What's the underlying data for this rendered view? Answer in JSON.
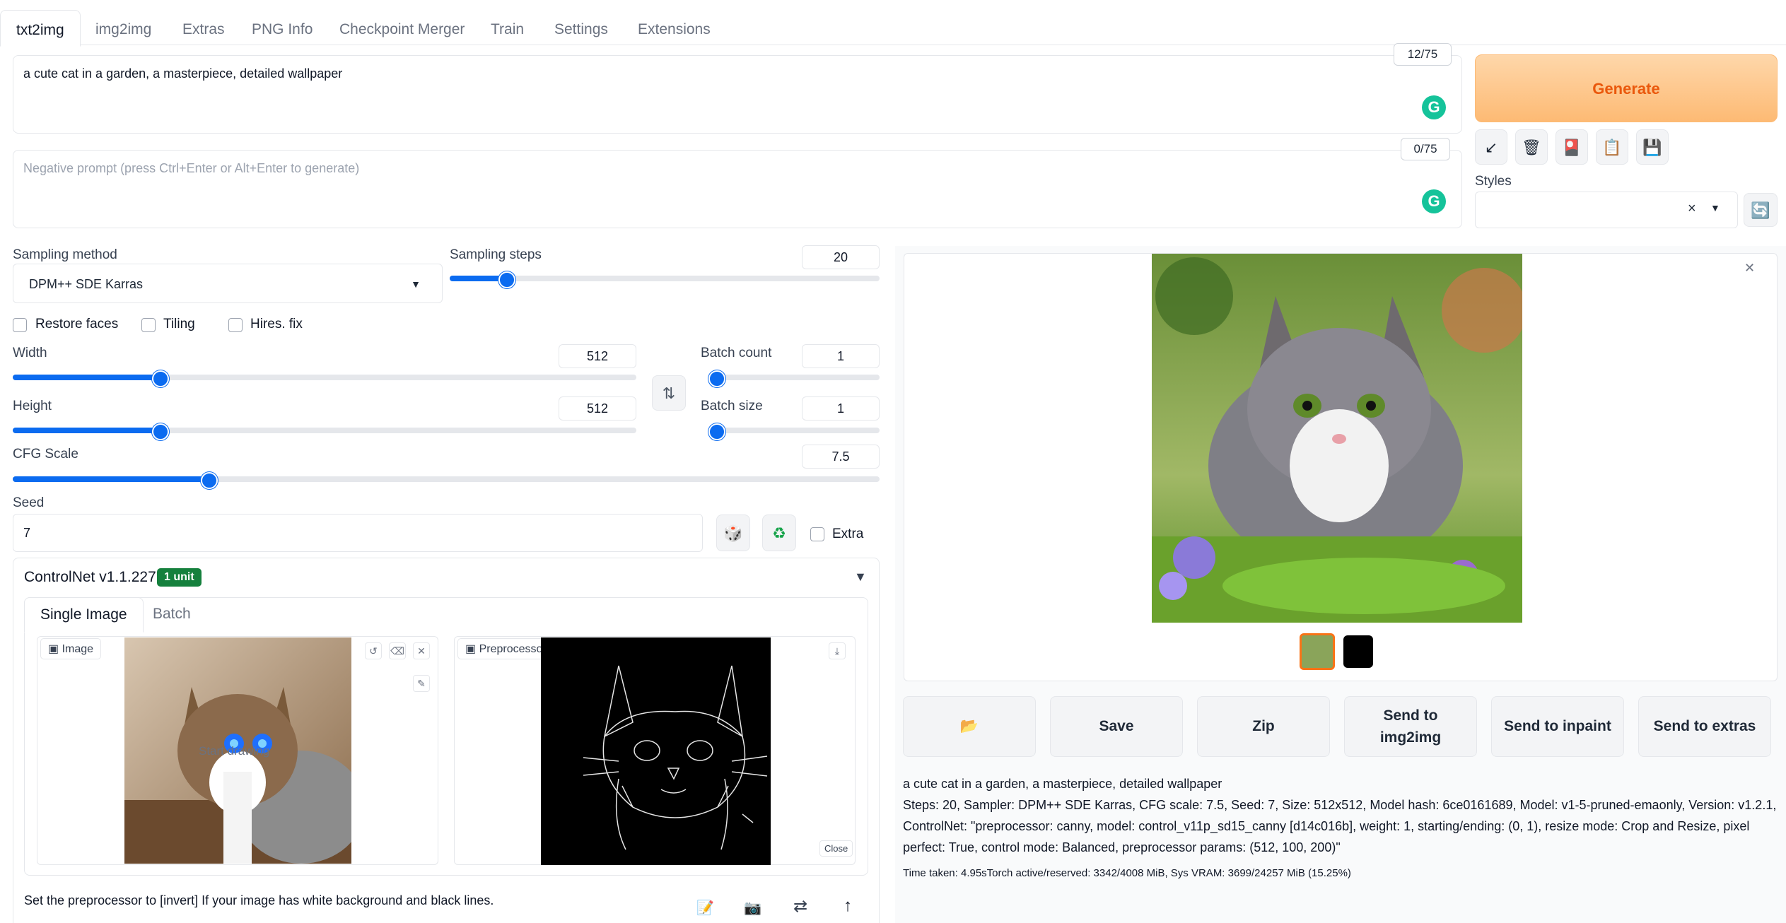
{
  "tabs": [
    {
      "label": "txt2img",
      "active": true
    },
    {
      "label": "img2img"
    },
    {
      "label": "Extras"
    },
    {
      "label": "PNG Info"
    },
    {
      "label": "Checkpoint Merger"
    },
    {
      "label": "Train"
    },
    {
      "label": "Settings"
    },
    {
      "label": "Extensions"
    }
  ],
  "prompt": {
    "value": "a cute cat in a garden, a masterpiece, detailed wallpaper",
    "counter": "12/75"
  },
  "negative_prompt": {
    "placeholder": "Negative prompt (press Ctrl+Enter or Alt+Enter to generate)",
    "counter": "0/75"
  },
  "generate_label": "Generate",
  "toolbar_icons": [
    "arrow-down-left-icon",
    "trash-icon",
    "red-card-icon",
    "clipboard-icon",
    "save-icon"
  ],
  "styles": {
    "label": "Styles",
    "value": ""
  },
  "sampling": {
    "method_label": "Sampling method",
    "method_value": "DPM++ SDE Karras",
    "steps_label": "Sampling steps",
    "steps_value": "20",
    "steps_fraction": 0.13
  },
  "checkboxes": {
    "restore_faces": "Restore faces",
    "tiling": "Tiling",
    "hires_fix": "Hires. fix",
    "extra": "Extra"
  },
  "width": {
    "label": "Width",
    "value": "512",
    "fraction": 0.235
  },
  "height": {
    "label": "Height",
    "value": "512",
    "fraction": 0.235
  },
  "batch_count": {
    "label": "Batch count",
    "value": "1",
    "fraction": 0.0
  },
  "batch_size": {
    "label": "Batch size",
    "value": "1",
    "fraction": 0.0
  },
  "cfg": {
    "label": "CFG Scale",
    "value": "7.5",
    "fraction": 0.225
  },
  "seed": {
    "label": "Seed",
    "value": "7"
  },
  "controlnet": {
    "title": "ControlNet v1.1.227",
    "badge": "1 unit",
    "tabs": [
      "Single Image",
      "Batch"
    ],
    "image_label": "Image",
    "preview_label": "Preprocessor Preview",
    "close_label": "Close",
    "hint": "Set the preprocessor to [invert] If your image has white background and black lines."
  },
  "actions": [
    "Save",
    "Zip",
    "Send to img2img",
    "Send to inpaint",
    "Send to extras"
  ],
  "output_info": {
    "prompt": "a cute cat in a garden, a masterpiece, detailed wallpaper",
    "params": "Steps: 20, Sampler: DPM++ SDE Karras, CFG scale: 7.5, Seed: 7, Size: 512x512, Model hash: 6ce0161689, Model: v1-5-pruned-emaonly, Version: v1.2.1, ControlNet: \"preprocessor: canny, model: control_v11p_sd15_canny [d14c016b], weight: 1, starting/ending: (0, 1), resize mode: Crop and Resize, pixel perfect: True, control mode: Balanced, preprocessor params: (512, 100, 200)\"",
    "timing": "Time taken: 4.95sTorch active/reserved: 3342/4008 MiB, Sys VRAM: 3699/24257 MiB (15.25%)"
  },
  "colors": {
    "accent": "#0b6bf0",
    "generate": "#ea580c",
    "badge": "#15803d"
  }
}
